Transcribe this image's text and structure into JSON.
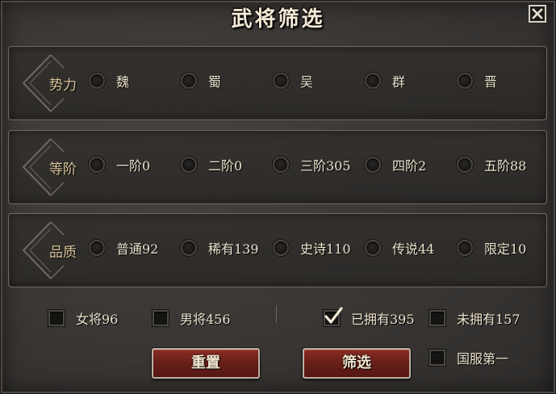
{
  "dialog": {
    "title": "武将筛选"
  },
  "filters": {
    "faction": {
      "label": "势力",
      "options": [
        "魏",
        "蜀",
        "吴",
        "群",
        "晋"
      ]
    },
    "tier": {
      "label": "等阶",
      "options": [
        "一阶0",
        "二阶0",
        "三阶305",
        "四阶2",
        "五阶88"
      ]
    },
    "quality": {
      "label": "品质",
      "options": [
        "普通92",
        "稀有139",
        "史诗110",
        "传说44",
        "限定10"
      ]
    }
  },
  "toggles": {
    "female": {
      "label": "女将96",
      "checked": false
    },
    "male": {
      "label": "男将456",
      "checked": false
    },
    "owned": {
      "label": "已拥有395",
      "checked": true
    },
    "not_owned": {
      "label": "未拥有157",
      "checked": false
    },
    "server_first": {
      "label": "国服第一",
      "checked": false
    }
  },
  "buttons": {
    "reset": "重置",
    "filter": "筛选"
  },
  "icons": {
    "close": "close-icon",
    "check": "checkmark-icon",
    "decor": "diamond-ornament-icon"
  },
  "colors": {
    "accent_red": "#6a1f19",
    "category_gold": "#d9c49a",
    "text": "#ece2cc"
  }
}
